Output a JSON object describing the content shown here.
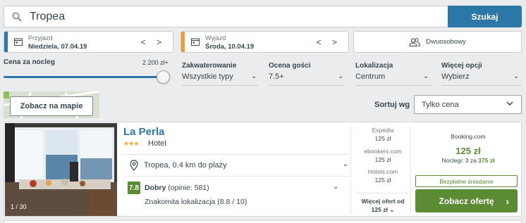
{
  "search": {
    "value": "Tropea",
    "button_label": "Szukaj"
  },
  "checkin": {
    "label": "Przyjazd",
    "value": "Niedziela, 07.04.19",
    "accent": "#2b77a8"
  },
  "checkout": {
    "label": "Wyjazd",
    "value": "Środa, 10.04.19",
    "accent": "#f39a2b"
  },
  "arrows": "< >",
  "room": {
    "label": "Dwuosobowy",
    "icon": "users-icon"
  },
  "filters": {
    "price": {
      "label": "Cena za nocleg",
      "max": "2 200 zł+",
      "slider_level": 1.0
    },
    "accommodation": {
      "label": "Zakwaterowanie",
      "value": "Wszystkie typy"
    },
    "rating": {
      "label": "Ocena gości",
      "value": "7.5+"
    },
    "location": {
      "label": "Lokalizacja",
      "value": "Centrum"
    },
    "more": {
      "label": "Więcej opcji",
      "value": "Wybierz"
    }
  },
  "map_button": "Zobacz na mapie",
  "sort": {
    "label": "Sortuj wg",
    "value": "Tylko cena"
  },
  "hotel": {
    "name": "La Perla",
    "stars": "★★★",
    "type": "Hotel",
    "photo_count": "1 / 30",
    "location": "Tropea, 0.4 km do plaży",
    "rating_score": "7.8",
    "rating_word": "Dobry",
    "rating_reviews": "(opinie: 581)",
    "location_score": "Znakomita lokalizacja (8.8 / 10)",
    "deals": [
      {
        "site": "Expedia",
        "price": "125 zł"
      },
      {
        "site": "ebookers.com",
        "price": "125 zł"
      },
      {
        "site": "Hotels.com",
        "price": "125 zł"
      }
    ],
    "more_offers_label": "Więcej ofert od",
    "more_offers_price": "125 zł",
    "best_site": "Booking.com",
    "best_price": "125 zł",
    "nights_prefix": "Noclegi: 3 za",
    "nights_total": "375 zł",
    "breakfast": "Bezpłatne śniadanie",
    "offer_button": "Zobacz ofertę"
  }
}
